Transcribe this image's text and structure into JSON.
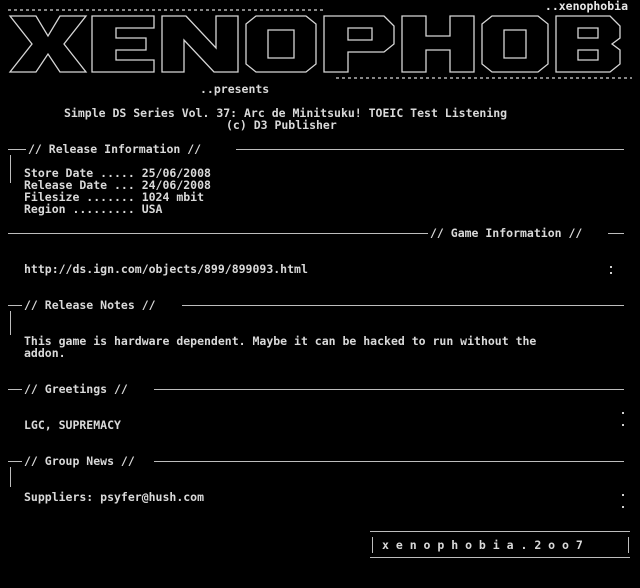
{
  "group_tag": "..xenophobia",
  "presents": "..presents",
  "title": "Simple DS Series Vol. 37: Arc de Minitsuku! TOEIC Test Listening",
  "publisher": "(c) D3 Publisher",
  "sections": {
    "release_info": {
      "header": "// Release Information //",
      "store_date": "Store Date ..... 25/06/2008",
      "release_date": "Release Date ... 24/06/2008",
      "filesize": "Filesize ....... 1024 mbit",
      "region": "Region ......... USA"
    },
    "game_info": {
      "header": "// Game Information //",
      "url": "http://ds.ign.com/objects/899/899093.html"
    },
    "release_notes": {
      "header": "// Release Notes //",
      "line1": "This game is hardware dependent. Maybe it can be hacked to run without the",
      "line2": "addon."
    },
    "greetings": {
      "header": "// Greetings //",
      "text": "LGC, SUPREMACY"
    },
    "group_news": {
      "header": "// Group News //",
      "text": "Suppliers: psyfer@hush.com"
    }
  },
  "footer_tag": "x e n o p h o b i a . 2 o o 7"
}
